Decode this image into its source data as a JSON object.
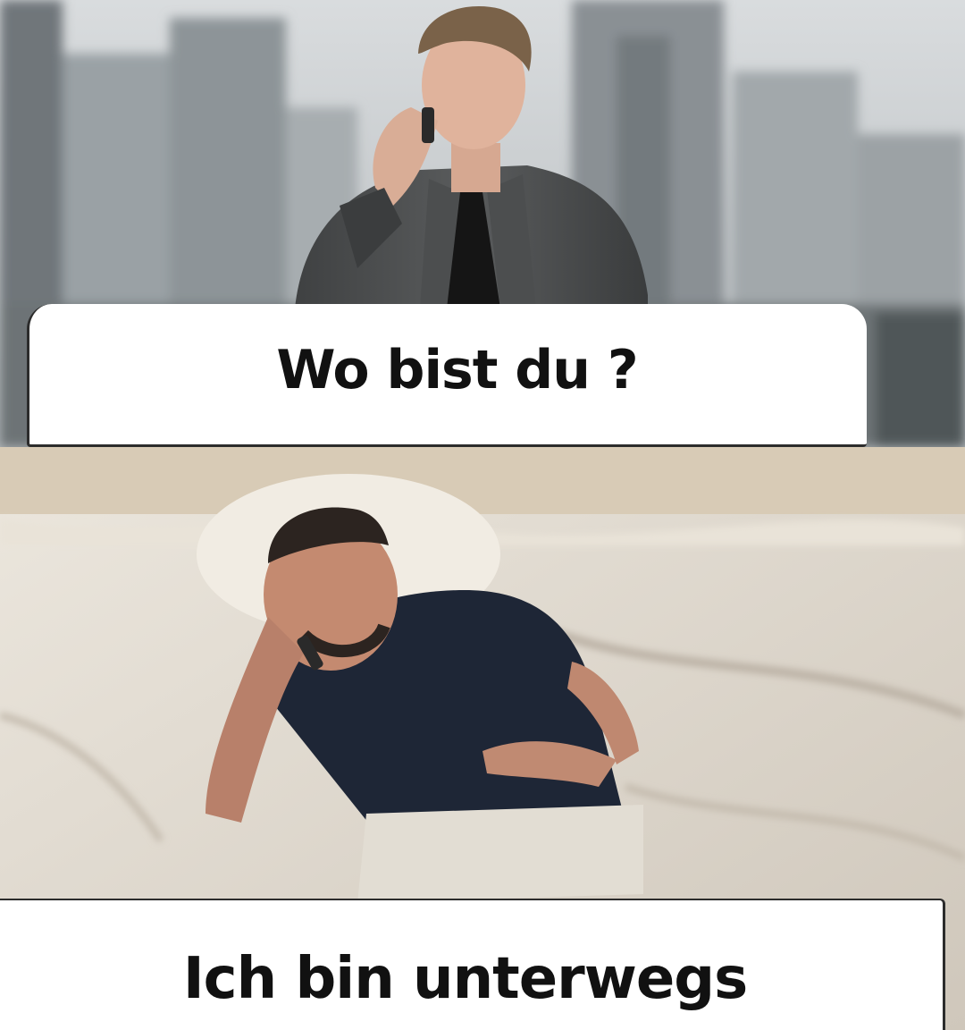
{
  "top_caption": "Wo bist du ?",
  "bottom_caption": "Ich bin unterwegs",
  "colors": {
    "caption_text": "#111111",
    "caption_bg": "#ffffff",
    "city_sky": "#c9cdd0",
    "jacket": "#4a4c4d",
    "sheet": "#e4ddd2",
    "tshirt": "#1d2433"
  }
}
